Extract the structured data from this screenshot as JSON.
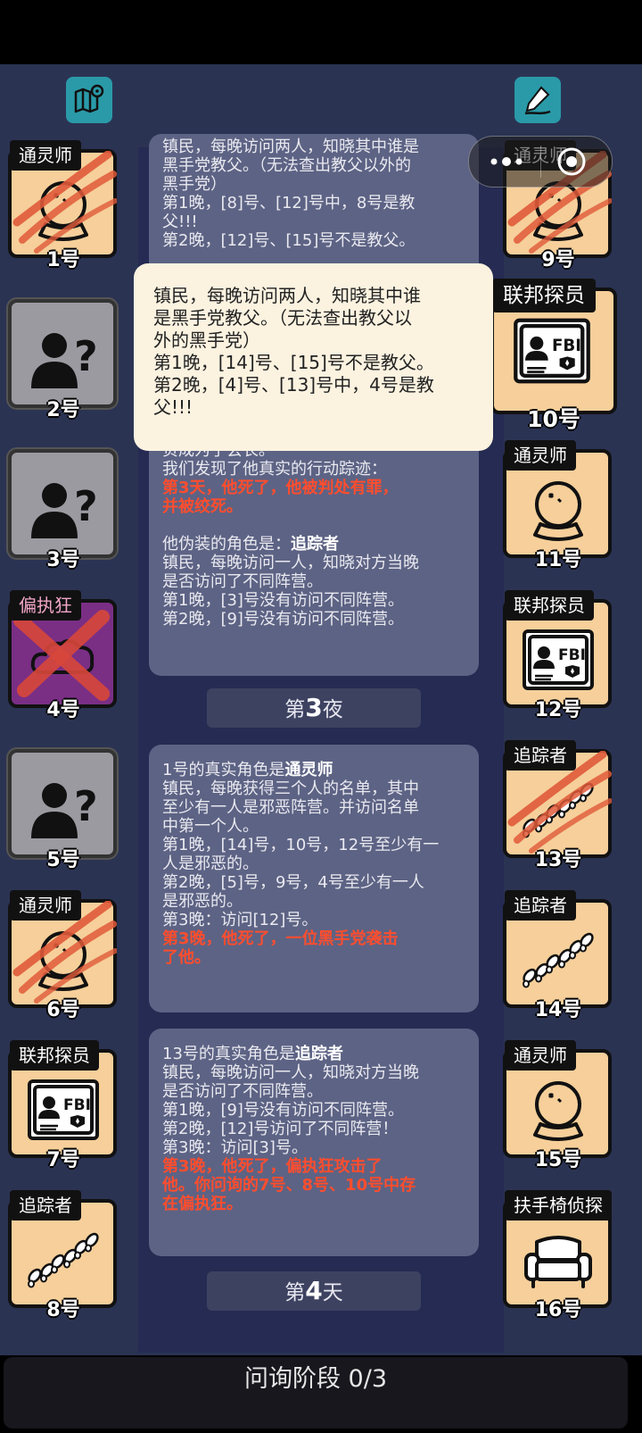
{
  "top": {
    "left_icon": "map-pin-icon",
    "right_icon": "pencil-sign-icon"
  },
  "capsule": {
    "more_icon": "more-dots-icon",
    "close_icon": "target-close-icon"
  },
  "left_cards": [
    {
      "role": "通灵师",
      "num": "1号",
      "style": "beige",
      "icon": "crystal-ball",
      "dead": true
    },
    {
      "role": "",
      "num": "2号",
      "style": "gray",
      "icon": "unknown-person"
    },
    {
      "role": "",
      "num": "3号",
      "style": "gray",
      "icon": "unknown-person"
    },
    {
      "role": "偏执狂",
      "num": "4号",
      "style": "purple",
      "icon": "cloud",
      "dead": true
    },
    {
      "role": "",
      "num": "5号",
      "style": "gray",
      "icon": "unknown-person"
    },
    {
      "role": "通灵师",
      "num": "6号",
      "style": "beige",
      "icon": "crystal-ball",
      "dead": true
    },
    {
      "role": "联邦探员",
      "num": "7号",
      "style": "beige",
      "icon": "fbi-badge"
    },
    {
      "role": "追踪者",
      "num": "8号",
      "style": "beige",
      "icon": "footprints"
    }
  ],
  "right_cards": [
    {
      "role": "通灵师",
      "num": "9号",
      "icon": "crystal-ball",
      "dead": true
    },
    {
      "role": "联邦探员",
      "num": "10号",
      "icon": "fbi-badge"
    },
    {
      "role": "通灵师",
      "num": "11号",
      "icon": "crystal-ball"
    },
    {
      "role": "联邦探员",
      "num": "12号",
      "icon": "fbi-badge"
    },
    {
      "role": "追踪者",
      "num": "13号",
      "icon": "footprints",
      "dead": true
    },
    {
      "role": "追踪者",
      "num": "14号",
      "icon": "footprints"
    },
    {
      "role": "通灵师",
      "num": "15号",
      "icon": "crystal-ball"
    },
    {
      "role": "扶手椅侦探",
      "num": "16号",
      "icon": "armchair"
    }
  ],
  "panel1": {
    "l1": "镇民，每晚访问两人，知晓其中谁是",
    "l2": "黑手党教父。（无法查出教父以外的",
    "l3": "黑手党）",
    "l4": "第1晚，[8]号、[12]号中，8号是教",
    "l5": "父!!!",
    "l6": "第2晚，[12]号、[15]号不是教父。"
  },
  "panel2": {
    "l0": "负成为了会长。",
    "l1": "我们发现了他真实的行动踪迹：",
    "l2": "第3天，他死了，他被判处有罪，",
    "l3": "并被绞死。",
    "l4a": "他伪装的角色是：",
    "l4b": "追踪者",
    "l5": "镇民，每晚访问一人，知晓对方当晚",
    "l6": "是否访问了不同阵营。",
    "l7": "第1晚，[3]号没有访问不同阵营。",
    "l8": "第2晚，[9]号没有访问不同阵营。"
  },
  "day3": {
    "pre": "第",
    "n": "3",
    "post": "夜"
  },
  "panel3": {
    "l1a": "1号的真实角色是",
    "l1b": "通灵师",
    "l2": "镇民，每晚获得三个人的名单，其中",
    "l3": "至少有一人是邪恶阵营。并访问名单",
    "l4": "中第一个人。",
    "l5": "第1晚，[14]号，10号，12号至少有一",
    "l6": "人是邪恶的。",
    "l7": "第2晚，[5]号，9号，4号至少有一人",
    "l8": "是邪恶的。",
    "l9": "第3晚：访问[12]号。",
    "l10": "第3晚，他死了，一位黑手党袭击",
    "l11": "了他。"
  },
  "panel4": {
    "l1a": "13号的真实角色是",
    "l1b": "追踪者",
    "l2": "镇民，每晚访问一人，知晓对方当晚",
    "l3": "是否访问了不同阵营。",
    "l4": "第1晚，[9]号没有访问不同阵营。",
    "l5": "第2晚，[12]号访问了不同阵营！",
    "l6": "第3晚：访问[3]号。",
    "l7": "第3晚，他死了，偏执狂攻击了",
    "l8": "他。你问询的7号、8号、10号中存",
    "l9": "在偏执狂。"
  },
  "day4": {
    "pre": "第",
    "n": "4",
    "post": "天"
  },
  "popup": {
    "l1": "镇民，每晚访问两人，知晓其中谁",
    "l2": "是黑手党教父。（无法查出教父以",
    "l3": "外的黑手党）",
    "l4": "第1晚，[14]号、[15]号不是教父。",
    "l5": "第2晚，[4]号、[13]号中，4号是教",
    "l6": "父!!!"
  },
  "bottom": {
    "label": "问询阶段 0/3"
  },
  "colors": {
    "beige": "#f6cf9a",
    "gray": "#9c9aa1",
    "purple": "#7a2f85",
    "red_text": "#ff4d2e",
    "panel": "#5d6384"
  }
}
